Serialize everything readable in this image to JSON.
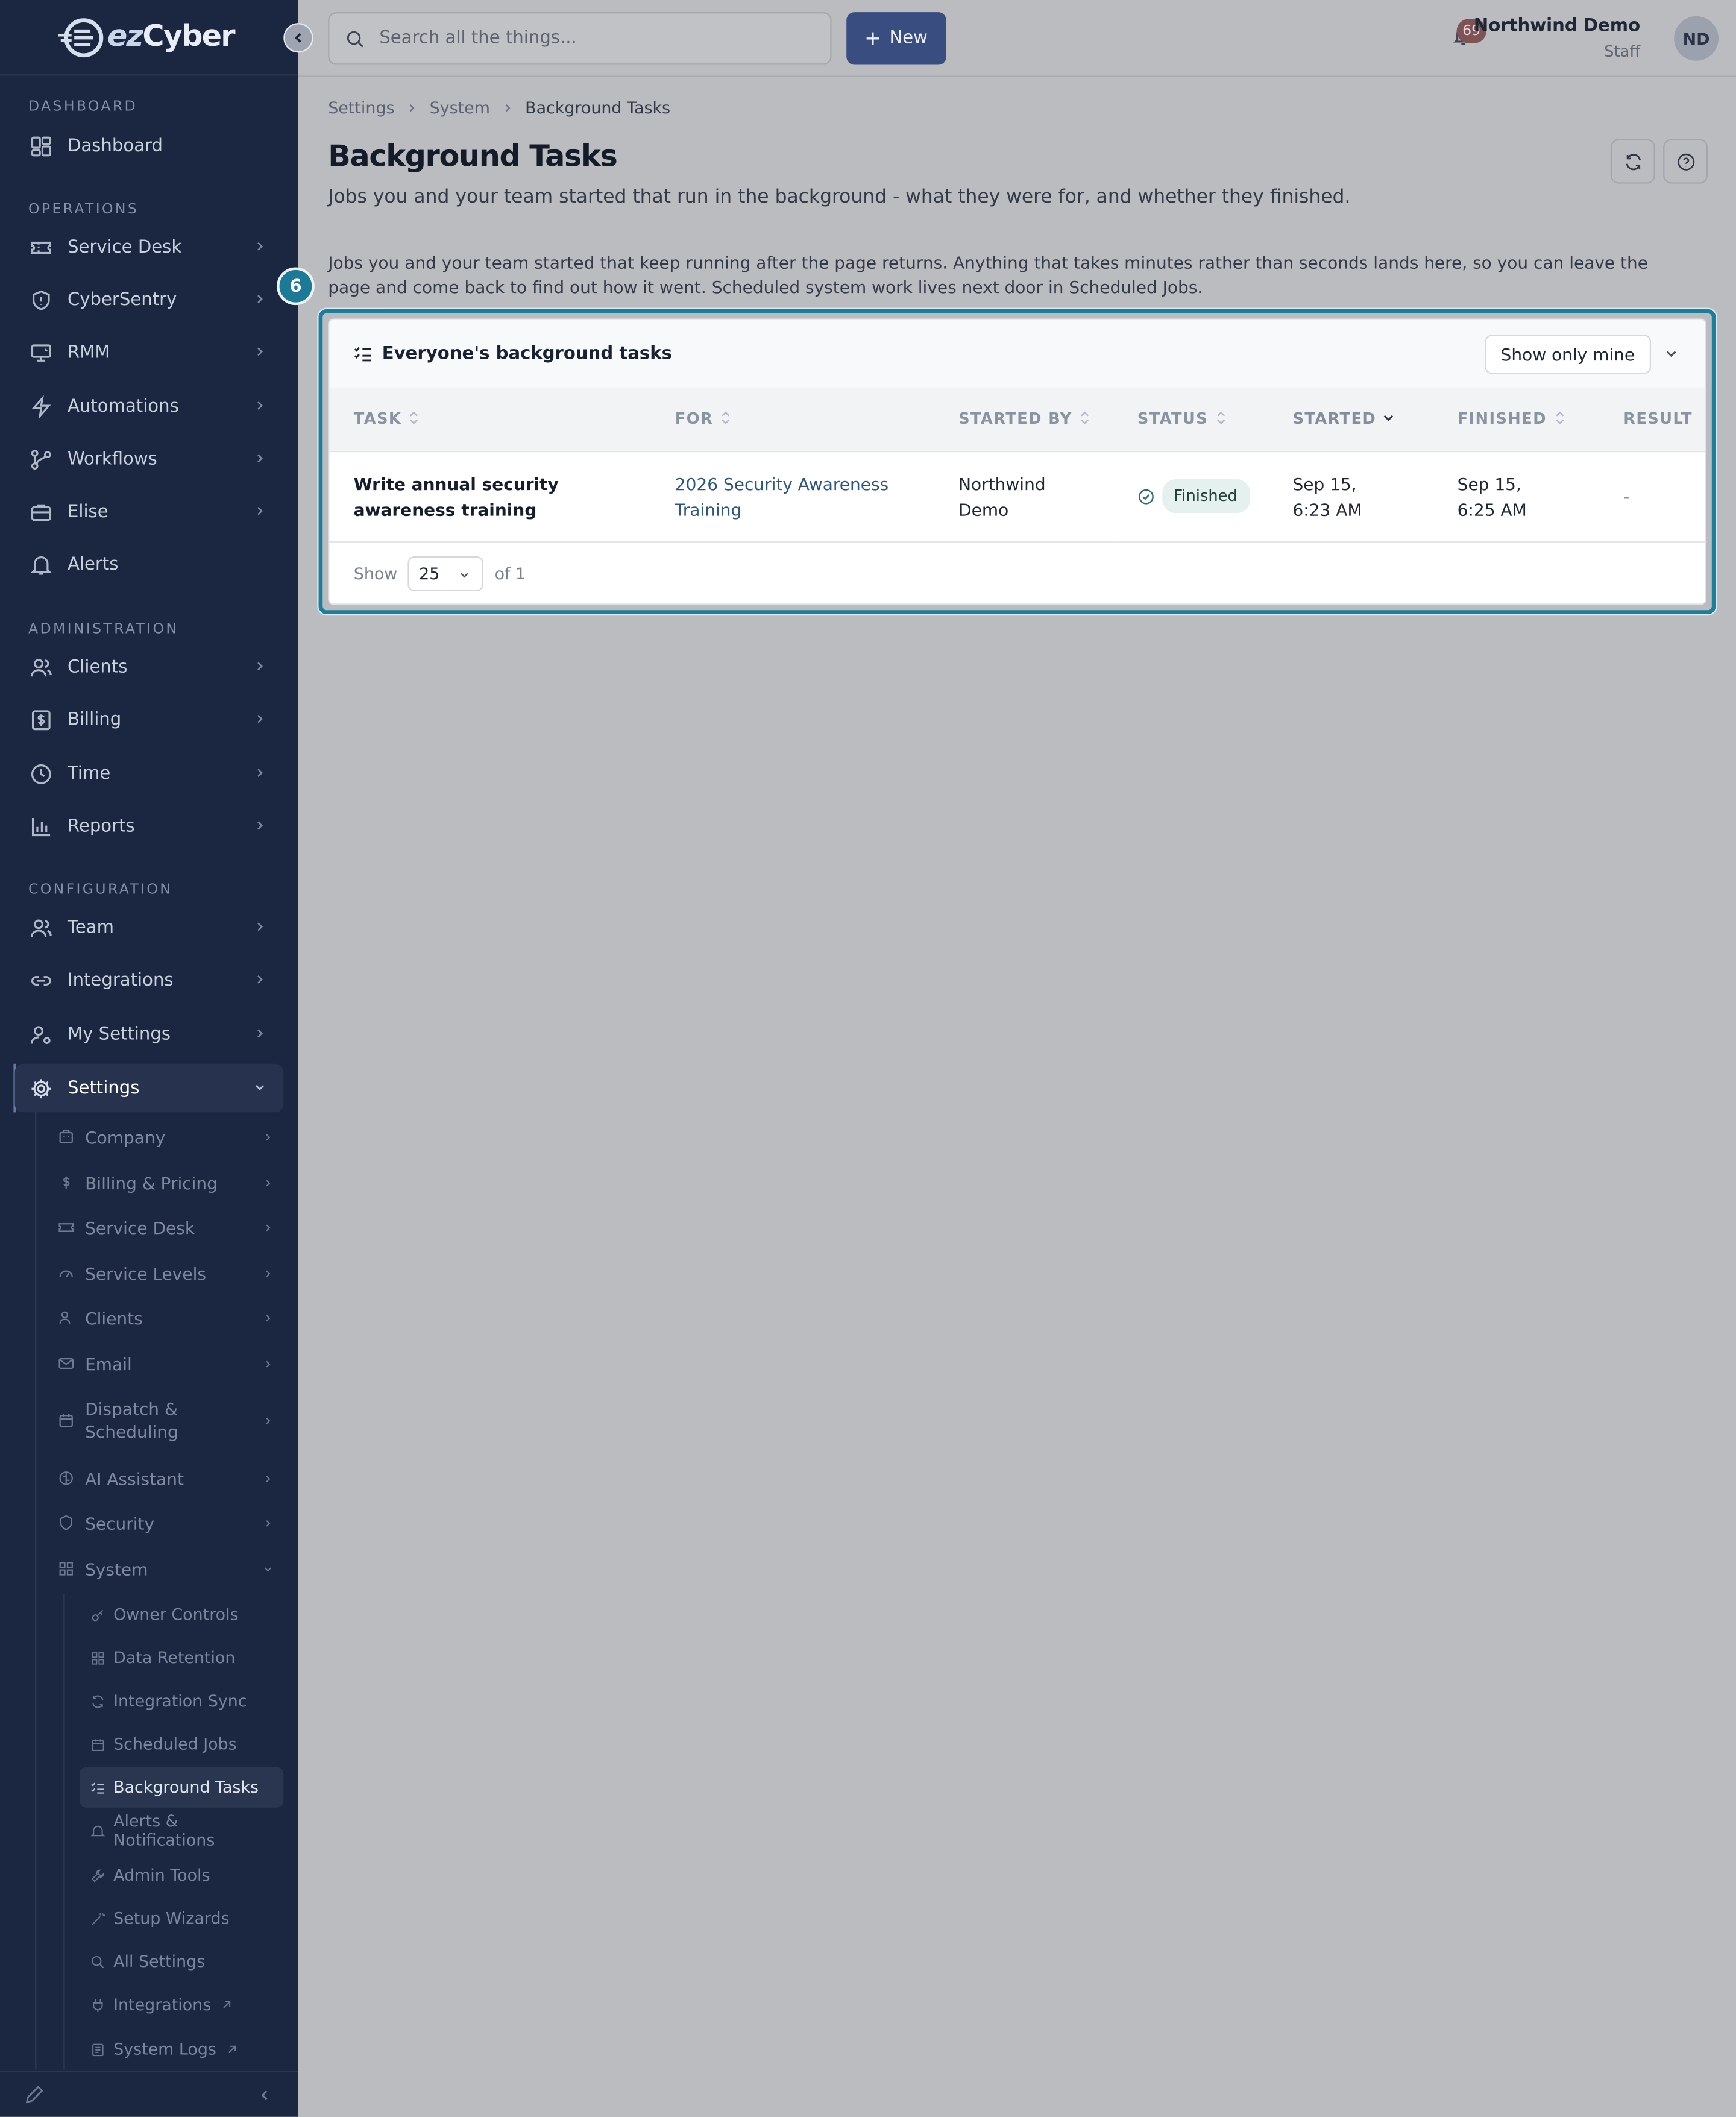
{
  "app": {
    "logo_text_ez": "ez",
    "logo_text_cyber": "Cyber"
  },
  "sidebar": {
    "sections": {
      "dashboard": "DASHBOARD",
      "operations": "OPERATIONS",
      "administration": "ADMINISTRATION",
      "configuration": "CONFIGURATION"
    },
    "items": [
      {
        "label": "Dashboard",
        "icon": "dashboard-icon"
      },
      {
        "label": "Service Desk",
        "icon": "ticket-icon"
      },
      {
        "label": "CyberSentry",
        "icon": "shield-icon"
      },
      {
        "label": "RMM",
        "icon": "monitor-icon"
      },
      {
        "label": "Automations",
        "icon": "bolt-icon"
      },
      {
        "label": "Workflows",
        "icon": "workflow-icon"
      },
      {
        "label": "Elise",
        "icon": "briefcase-icon"
      },
      {
        "label": "Alerts",
        "icon": "bell-icon"
      },
      {
        "label": "Clients",
        "icon": "users-icon"
      },
      {
        "label": "Billing",
        "icon": "dollar-icon"
      },
      {
        "label": "Time",
        "icon": "clock-icon"
      },
      {
        "label": "Reports",
        "icon": "bar-chart-icon"
      },
      {
        "label": "Team",
        "icon": "team-icon"
      },
      {
        "label": "Integrations",
        "icon": "link-icon"
      },
      {
        "label": "My Settings",
        "icon": "user-cog-icon"
      },
      {
        "label": "Settings",
        "icon": "gear-icon"
      }
    ],
    "settings_sub": [
      {
        "label": "Company",
        "icon": "building-icon"
      },
      {
        "label": "Billing & Pricing",
        "icon": "dollar-icon"
      },
      {
        "label": "Service Desk",
        "icon": "ticket-icon"
      },
      {
        "label": "Service Levels",
        "icon": "gauge-icon"
      },
      {
        "label": "Clients",
        "icon": "users-icon"
      },
      {
        "label": "Email",
        "icon": "mail-icon"
      },
      {
        "label": "Dispatch & Scheduling",
        "icon": "calendar-icon"
      },
      {
        "label": "AI Assistant",
        "icon": "brain-icon"
      },
      {
        "label": "Security",
        "icon": "shield-icon"
      },
      {
        "label": "System",
        "icon": "grid-icon"
      }
    ],
    "system_sub": [
      {
        "label": "Owner Controls",
        "icon": "key-icon"
      },
      {
        "label": "Data Retention",
        "icon": "database-icon"
      },
      {
        "label": "Integration Sync",
        "icon": "sync-icon"
      },
      {
        "label": "Scheduled Jobs",
        "icon": "calendar-icon"
      },
      {
        "label": "Background Tasks",
        "icon": "list-check-icon"
      },
      {
        "label": "Alerts & Notifications",
        "icon": "bell-icon"
      },
      {
        "label": "Admin Tools",
        "icon": "wrench-icon"
      },
      {
        "label": "Setup Wizards",
        "icon": "wand-icon"
      },
      {
        "label": "All Settings",
        "icon": "search-icon"
      },
      {
        "label": "Integrations",
        "icon": "plug-icon"
      },
      {
        "label": "System Logs",
        "icon": "log-icon"
      }
    ]
  },
  "topbar": {
    "search_placeholder": "Search all the things...",
    "new_label": "New",
    "notification_count": "69",
    "user_name": "Northwind Demo",
    "user_role": "Staff",
    "avatar_initials": "ND"
  },
  "breadcrumb": [
    "Settings",
    "System",
    "Background Tasks"
  ],
  "page": {
    "title": "Background Tasks",
    "subtitle": "Jobs you and your team started that run in the background - what they were for, and whether they finished.",
    "description": "Jobs you and your team started that keep running after the page returns. Anything that takes minutes rather than seconds lands here, so you can leave the page and come back to find out how it went. Scheduled system work lives next door in Scheduled Jobs.",
    "step_number": "6"
  },
  "card": {
    "title": "Everyone's background tasks",
    "filter_value": "Show only mine",
    "columns": [
      "TASK",
      "FOR",
      "STARTED BY",
      "STATUS",
      "STARTED",
      "FINISHED",
      "RESULT"
    ],
    "rows": [
      {
        "task": "Write annual security awareness training",
        "for": "2026 Security Awareness Training",
        "started_by": "Northwind Demo",
        "status": "Finished",
        "started": "Sep 15, 6:23 AM",
        "finished": "Sep 15, 6:25 AM",
        "result": "-"
      }
    ],
    "pager": {
      "show_label": "Show",
      "page_size": "25",
      "of_label": "of 1"
    }
  },
  "colors": {
    "sidebar_bg": "#1b2640",
    "accent": "#3a4d80",
    "highlight": "#1e7d9a",
    "status_finished": "#e5f1ee"
  }
}
